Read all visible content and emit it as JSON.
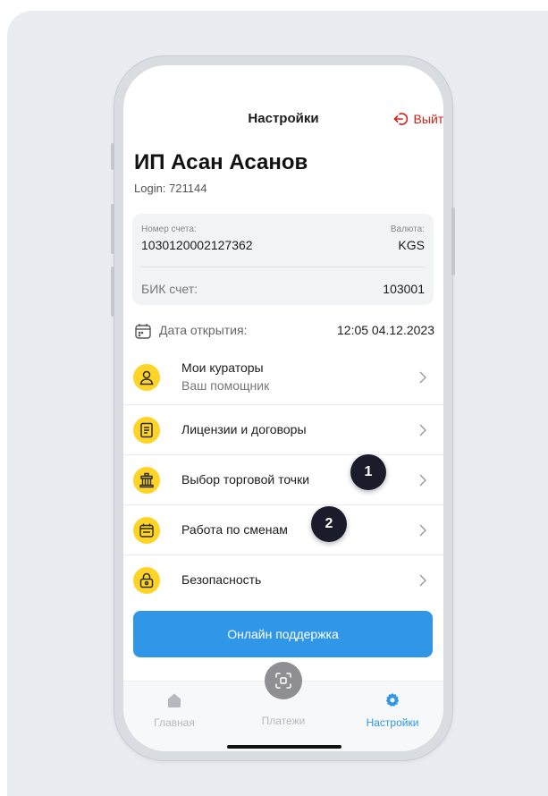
{
  "header": {
    "title": "Настройки",
    "logout_label": "Выйти"
  },
  "user": {
    "name": "ИП Асан Асанов",
    "login": "Login: 721144"
  },
  "account": {
    "number_label": "Номер счета:",
    "number": "1030120002127362",
    "currency_label": "Валюта:",
    "currency": "KGS",
    "bik_label": "БИК счет:",
    "bik": "103001"
  },
  "open_date": {
    "label": "Дата открытия:",
    "value": "12:05 04.12.2023"
  },
  "menu": [
    {
      "label": "Мои кураторы",
      "sublabel": "Ваш помощник",
      "icon": "person-icon"
    },
    {
      "label": "Лицензии и договоры",
      "icon": "document-icon"
    },
    {
      "label": "Выбор торговой точки",
      "icon": "store-icon"
    },
    {
      "label": "Работа по сменам",
      "icon": "calendar-icon"
    },
    {
      "label": "Безопасность",
      "icon": "lock-icon"
    }
  ],
  "badges": [
    "1",
    "2"
  ],
  "support_button": "Онлайн поддержка",
  "tabbar": [
    {
      "label": "Главная",
      "icon": "home-icon",
      "active": false
    },
    {
      "label": "Платежи",
      "icon": "scan-icon",
      "active": false
    },
    {
      "label": "Настройки",
      "icon": "gear-icon",
      "active": true
    }
  ],
  "colors": {
    "accent": "#2f96e8",
    "logout": "#d0201b",
    "icon_bg": "#ffd426",
    "badge": "#1b1c2b"
  }
}
